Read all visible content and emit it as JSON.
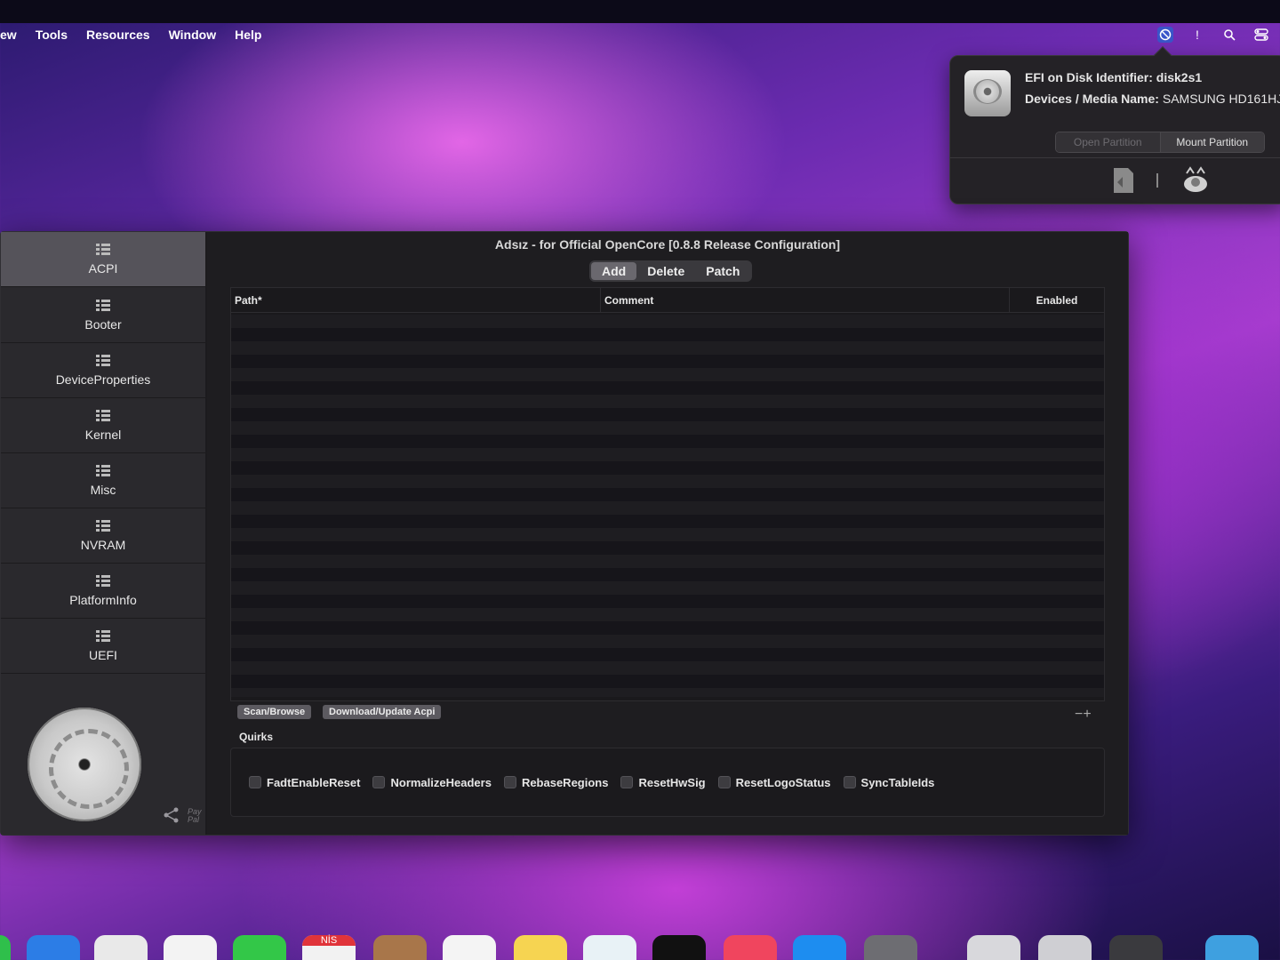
{
  "menubar": {
    "items": [
      "ew",
      "Tools",
      "Resources",
      "Window",
      "Help"
    ]
  },
  "popover": {
    "line1_label": "EFI on Disk Identifier:",
    "line1_value": "disk2s1",
    "line2_label": "Devices / Media Name:",
    "line2_value": "SAMSUNG HD161HJ",
    "open_partition": "Open Partition",
    "mount_partition": "Mount Partition"
  },
  "window": {
    "title": "Adsız - for Official OpenCore [0.8.8 Release Configuration]",
    "tabs": [
      "Add",
      "Delete",
      "Patch"
    ],
    "selected_tab": "Add",
    "table": {
      "columns": [
        "Path*",
        "Comment",
        "Enabled"
      ]
    },
    "buttons": {
      "scan": "Scan/Browse",
      "download": "Download/Update Acpi"
    },
    "quirks_label": "Quirks",
    "quirks": [
      "FadtEnableReset",
      "NormalizeHeaders",
      "RebaseRegions",
      "ResetHwSig",
      "ResetLogoStatus",
      "SyncTableIds"
    ]
  },
  "sidebar": {
    "items": [
      "ACPI",
      "Booter",
      "DeviceProperties",
      "Kernel",
      "Misc",
      "NVRAM",
      "PlatformInfo",
      "UEFI"
    ],
    "active": "ACPI",
    "paypal": "Pay Pal"
  },
  "dock": {
    "calendar_month": "NİS"
  }
}
